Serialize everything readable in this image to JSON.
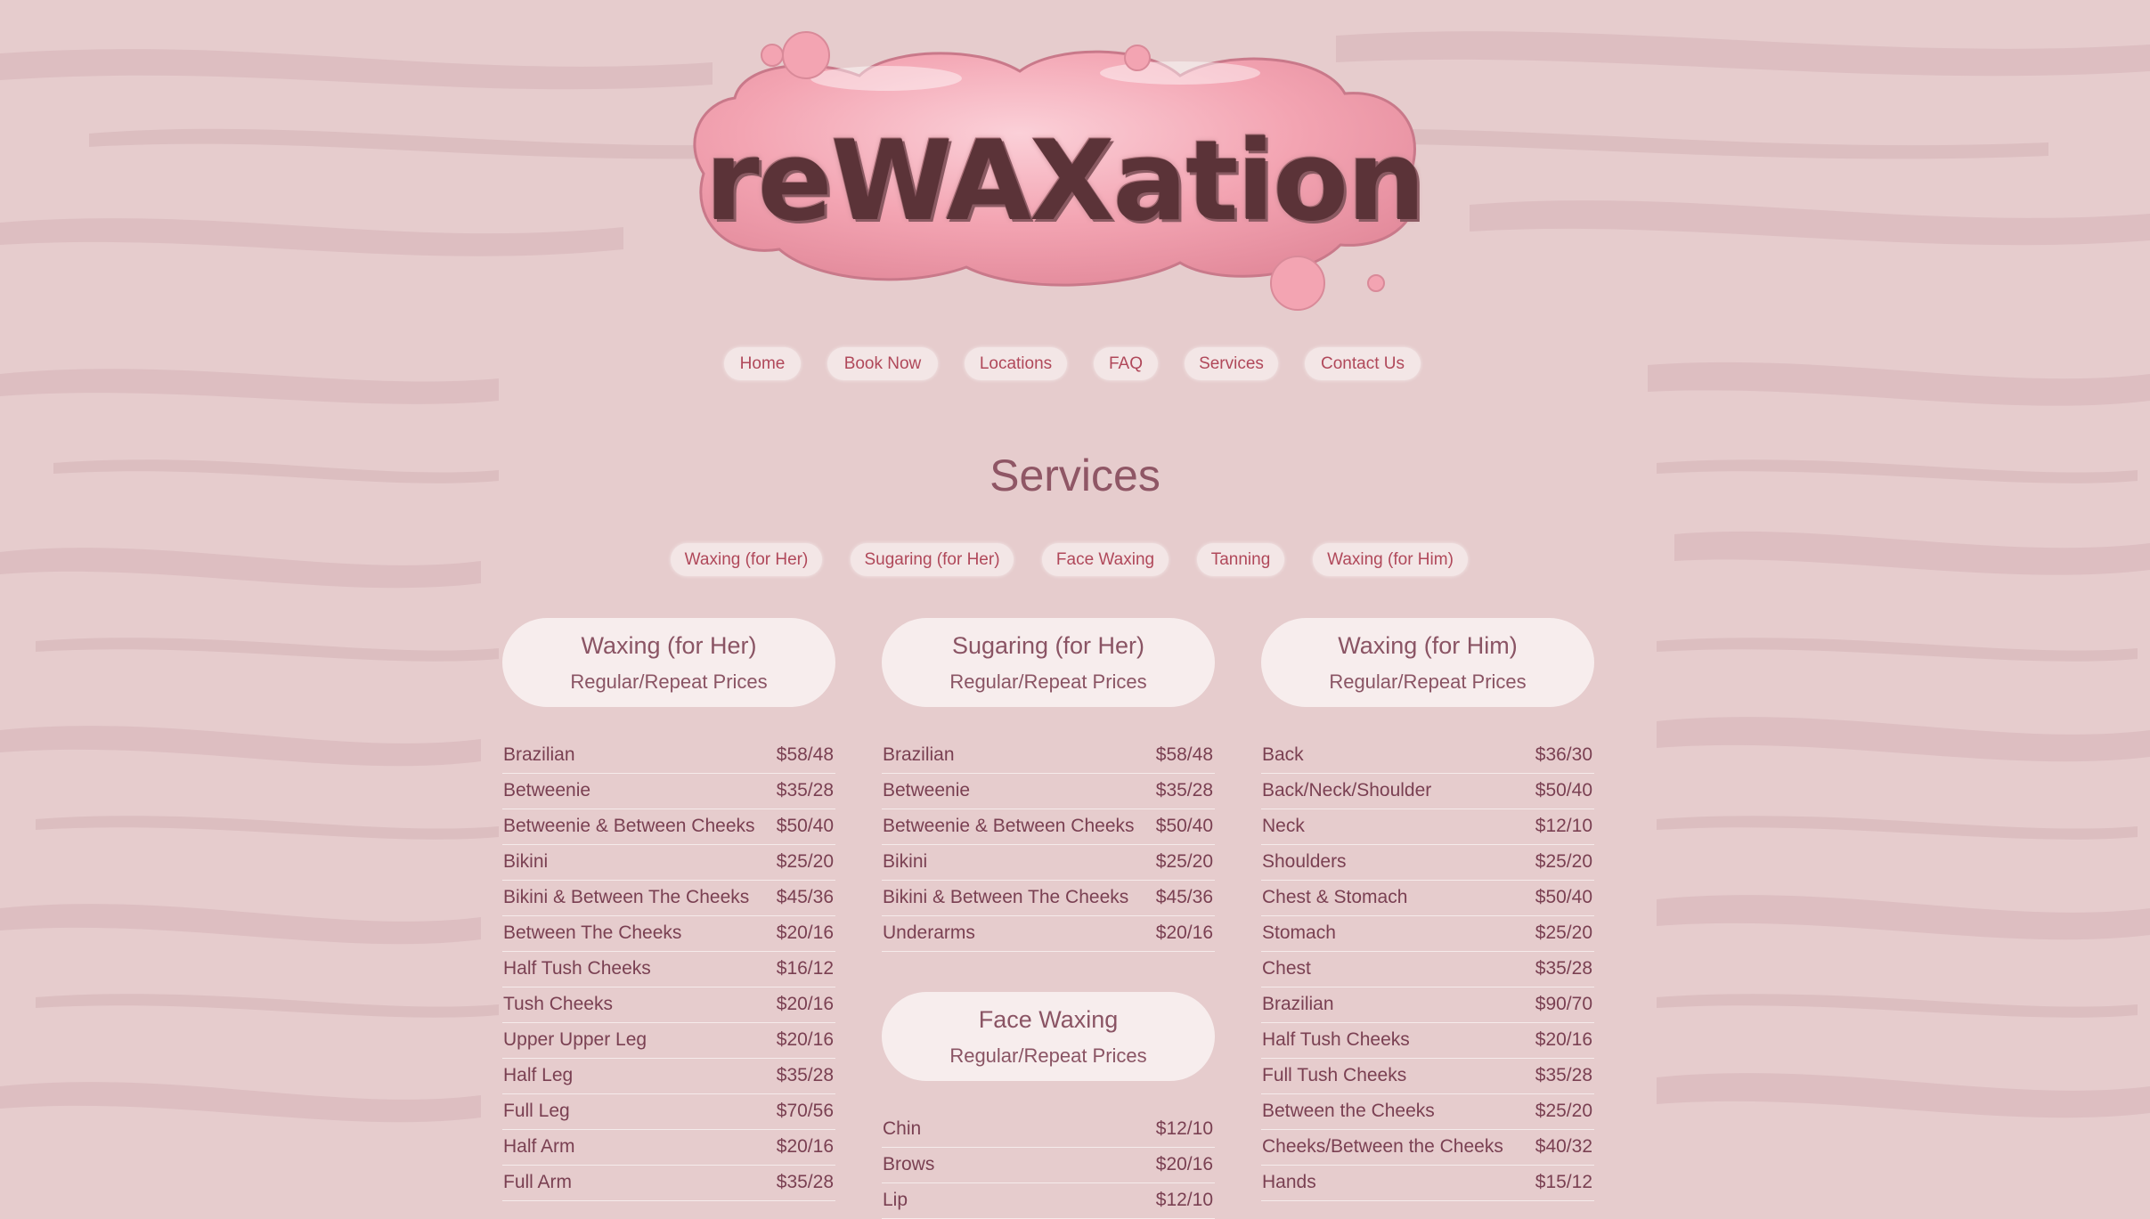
{
  "brand": {
    "logo_text": "reWAXation"
  },
  "nav": {
    "items": [
      {
        "label": "Home"
      },
      {
        "label": "Book Now"
      },
      {
        "label": "Locations"
      },
      {
        "label": "FAQ"
      },
      {
        "label": "Services"
      },
      {
        "label": "Contact Us"
      }
    ]
  },
  "page": {
    "title": "Services"
  },
  "service_tabs": [
    {
      "label": "Waxing (for Her)"
    },
    {
      "label": "Sugaring (for Her)"
    },
    {
      "label": "Face Waxing"
    },
    {
      "label": "Tanning"
    },
    {
      "label": "Waxing (for Him)"
    }
  ],
  "sections": {
    "waxing_her": {
      "title": "Waxing (for Her)",
      "subtitle": "Regular/Repeat Prices",
      "rows": [
        {
          "name": "Brazilian",
          "price": "$58/48"
        },
        {
          "name": "Betweenie",
          "price": "$35/28"
        },
        {
          "name": "Betweenie & Between Cheeks",
          "price": "$50/40"
        },
        {
          "name": "Bikini",
          "price": "$25/20"
        },
        {
          "name": "Bikini & Between The Cheeks",
          "price": "$45/36"
        },
        {
          "name": "Between The Cheeks",
          "price": "$20/16"
        },
        {
          "name": "Half Tush Cheeks",
          "price": "$16/12"
        },
        {
          "name": "Tush Cheeks",
          "price": "$20/16"
        },
        {
          "name": "Upper Upper Leg",
          "price": "$20/16"
        },
        {
          "name": "Half Leg",
          "price": "$35/28"
        },
        {
          "name": "Full Leg",
          "price": "$70/56"
        },
        {
          "name": "Half Arm",
          "price": "$20/16"
        },
        {
          "name": "Full Arm",
          "price": "$35/28"
        }
      ]
    },
    "sugaring_her": {
      "title": "Sugaring (for Her)",
      "subtitle": "Regular/Repeat Prices",
      "rows": [
        {
          "name": "Brazilian",
          "price": "$58/48"
        },
        {
          "name": "Betweenie",
          "price": "$35/28"
        },
        {
          "name": "Betweenie & Between Cheeks",
          "price": "$50/40"
        },
        {
          "name": "Bikini",
          "price": "$25/20"
        },
        {
          "name": "Bikini & Between The Cheeks",
          "price": "$45/36"
        },
        {
          "name": "Underarms",
          "price": "$20/16"
        }
      ]
    },
    "face_waxing": {
      "title": "Face Waxing",
      "subtitle": "Regular/Repeat Prices",
      "rows": [
        {
          "name": "Chin",
          "price": "$12/10"
        },
        {
          "name": "Brows",
          "price": "$20/16"
        },
        {
          "name": "Lip",
          "price": "$12/10"
        }
      ]
    },
    "waxing_him": {
      "title": "Waxing (for Him)",
      "subtitle": "Regular/Repeat Prices",
      "rows": [
        {
          "name": "Back",
          "price": "$36/30"
        },
        {
          "name": "Back/Neck/Shoulder",
          "price": "$50/40"
        },
        {
          "name": "Neck",
          "price": "$12/10"
        },
        {
          "name": "Shoulders",
          "price": "$25/20"
        },
        {
          "name": "Chest & Stomach",
          "price": "$50/40"
        },
        {
          "name": "Stomach",
          "price": "$25/20"
        },
        {
          "name": "Chest",
          "price": "$35/28"
        },
        {
          "name": "Brazilian",
          "price": "$90/70"
        },
        {
          "name": "Half Tush Cheeks",
          "price": "$20/16"
        },
        {
          "name": "Full Tush Cheeks",
          "price": "$35/28"
        },
        {
          "name": "Between the Cheeks",
          "price": "$25/20"
        },
        {
          "name": "Cheeks/Between the Cheeks",
          "price": "$40/32"
        },
        {
          "name": "Hands",
          "price": "$15/12"
        }
      ]
    }
  },
  "colors": {
    "background": "#e6cccd",
    "accent_link": "#b0485a",
    "text_primary": "#7a4052",
    "logo_pink": "#f2a8b4",
    "logo_text": "#5b3338"
  }
}
